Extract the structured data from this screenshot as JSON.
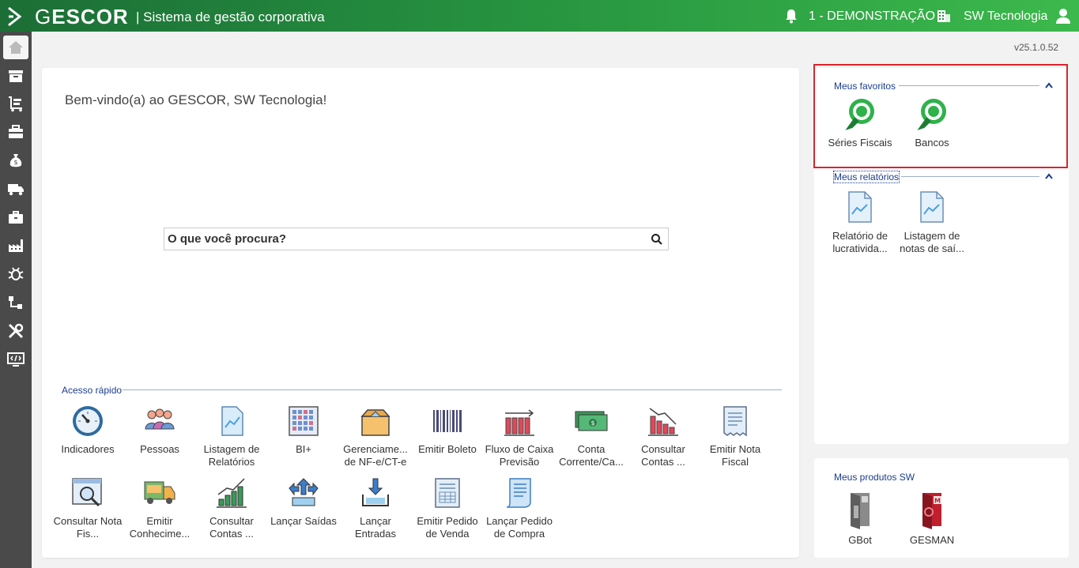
{
  "topbar": {
    "brand": "ESCOR",
    "brand_initial": "G",
    "subtitle": "| Sistema de gestão corporativa",
    "company": "1 - DEMONSTRAÇÃO",
    "user": "SW Tecnologia"
  },
  "version": "v25.1.0.52",
  "sidebar": {
    "items": [
      {
        "icon": "home-icon"
      },
      {
        "icon": "archive-icon"
      },
      {
        "icon": "cart-icon"
      },
      {
        "icon": "briefcase-icon"
      },
      {
        "icon": "money-bag-icon"
      },
      {
        "icon": "truck-icon"
      },
      {
        "icon": "toolbox-icon"
      },
      {
        "icon": "factory-icon"
      },
      {
        "icon": "bug-icon"
      },
      {
        "icon": "flow-icon"
      },
      {
        "icon": "tools-icon"
      },
      {
        "icon": "code-screen-icon"
      }
    ]
  },
  "main": {
    "welcome": "Bem-vindo(a) ao GESCOR, SW Tecnologia!",
    "search_placeholder": "O que você procura?",
    "quick_access_title": "Acesso rápido",
    "quick_access": [
      {
        "label": "Indicadores",
        "icon": "gauge-icon"
      },
      {
        "label": "Pessoas",
        "icon": "people-icon"
      },
      {
        "label": "Listagem de Relatórios",
        "icon": "report-list-icon"
      },
      {
        "label": "BI+",
        "icon": "grid-icon"
      },
      {
        "label": "Gerenciame... de NF-e/CT-e",
        "icon": "box-icon"
      },
      {
        "label": "Emitir Boleto",
        "icon": "barcode-icon"
      },
      {
        "label": "Fluxo de Caixa Previsão",
        "icon": "cashflow-icon"
      },
      {
        "label": "Conta Corrente/Ca...",
        "icon": "cash-icon"
      },
      {
        "label": "Consultar Contas ...",
        "icon": "chart-down-icon"
      },
      {
        "label": "Emitir Nota Fiscal",
        "icon": "invoice-icon"
      },
      {
        "label": "Consultar Nota Fis...",
        "icon": "search-window-icon"
      },
      {
        "label": "Emitir Conhecime...",
        "icon": "delivery-truck-icon"
      },
      {
        "label": "Consultar Contas ...",
        "icon": "chart-up-icon"
      },
      {
        "label": "Lançar Saídas",
        "icon": "outbound-icon"
      },
      {
        "label": "Lançar Entradas",
        "icon": "inbound-icon"
      },
      {
        "label": "Emitir Pedido de Venda",
        "icon": "sales-order-icon"
      },
      {
        "label": "Lançar Pedido de Compra",
        "icon": "purchase-order-icon"
      }
    ]
  },
  "favorites": {
    "title": "Meus favoritos",
    "items": [
      {
        "label": "Séries Fiscais",
        "icon": "favorite-pin-icon"
      },
      {
        "label": "Bancos",
        "icon": "favorite-pin-icon"
      }
    ]
  },
  "reports": {
    "title": "Meus relatórios",
    "items": [
      {
        "label": "Relatório de lucratividа...",
        "icon": "report-doc-icon"
      },
      {
        "label": "Listagem de notas de saí...",
        "icon": "report-doc-icon"
      }
    ]
  },
  "products": {
    "title": "Meus produtos SW",
    "items": [
      {
        "label": "GBot",
        "icon": "gbot-icon"
      },
      {
        "label": "GESMAN",
        "icon": "gesman-icon"
      }
    ]
  },
  "colors": {
    "topbar_start": "#1c6e36",
    "topbar_end": "#3cb94c",
    "sidebar": "#4a4a4a",
    "section_title": "#1a3d8f",
    "highlight": "#d9232d"
  }
}
